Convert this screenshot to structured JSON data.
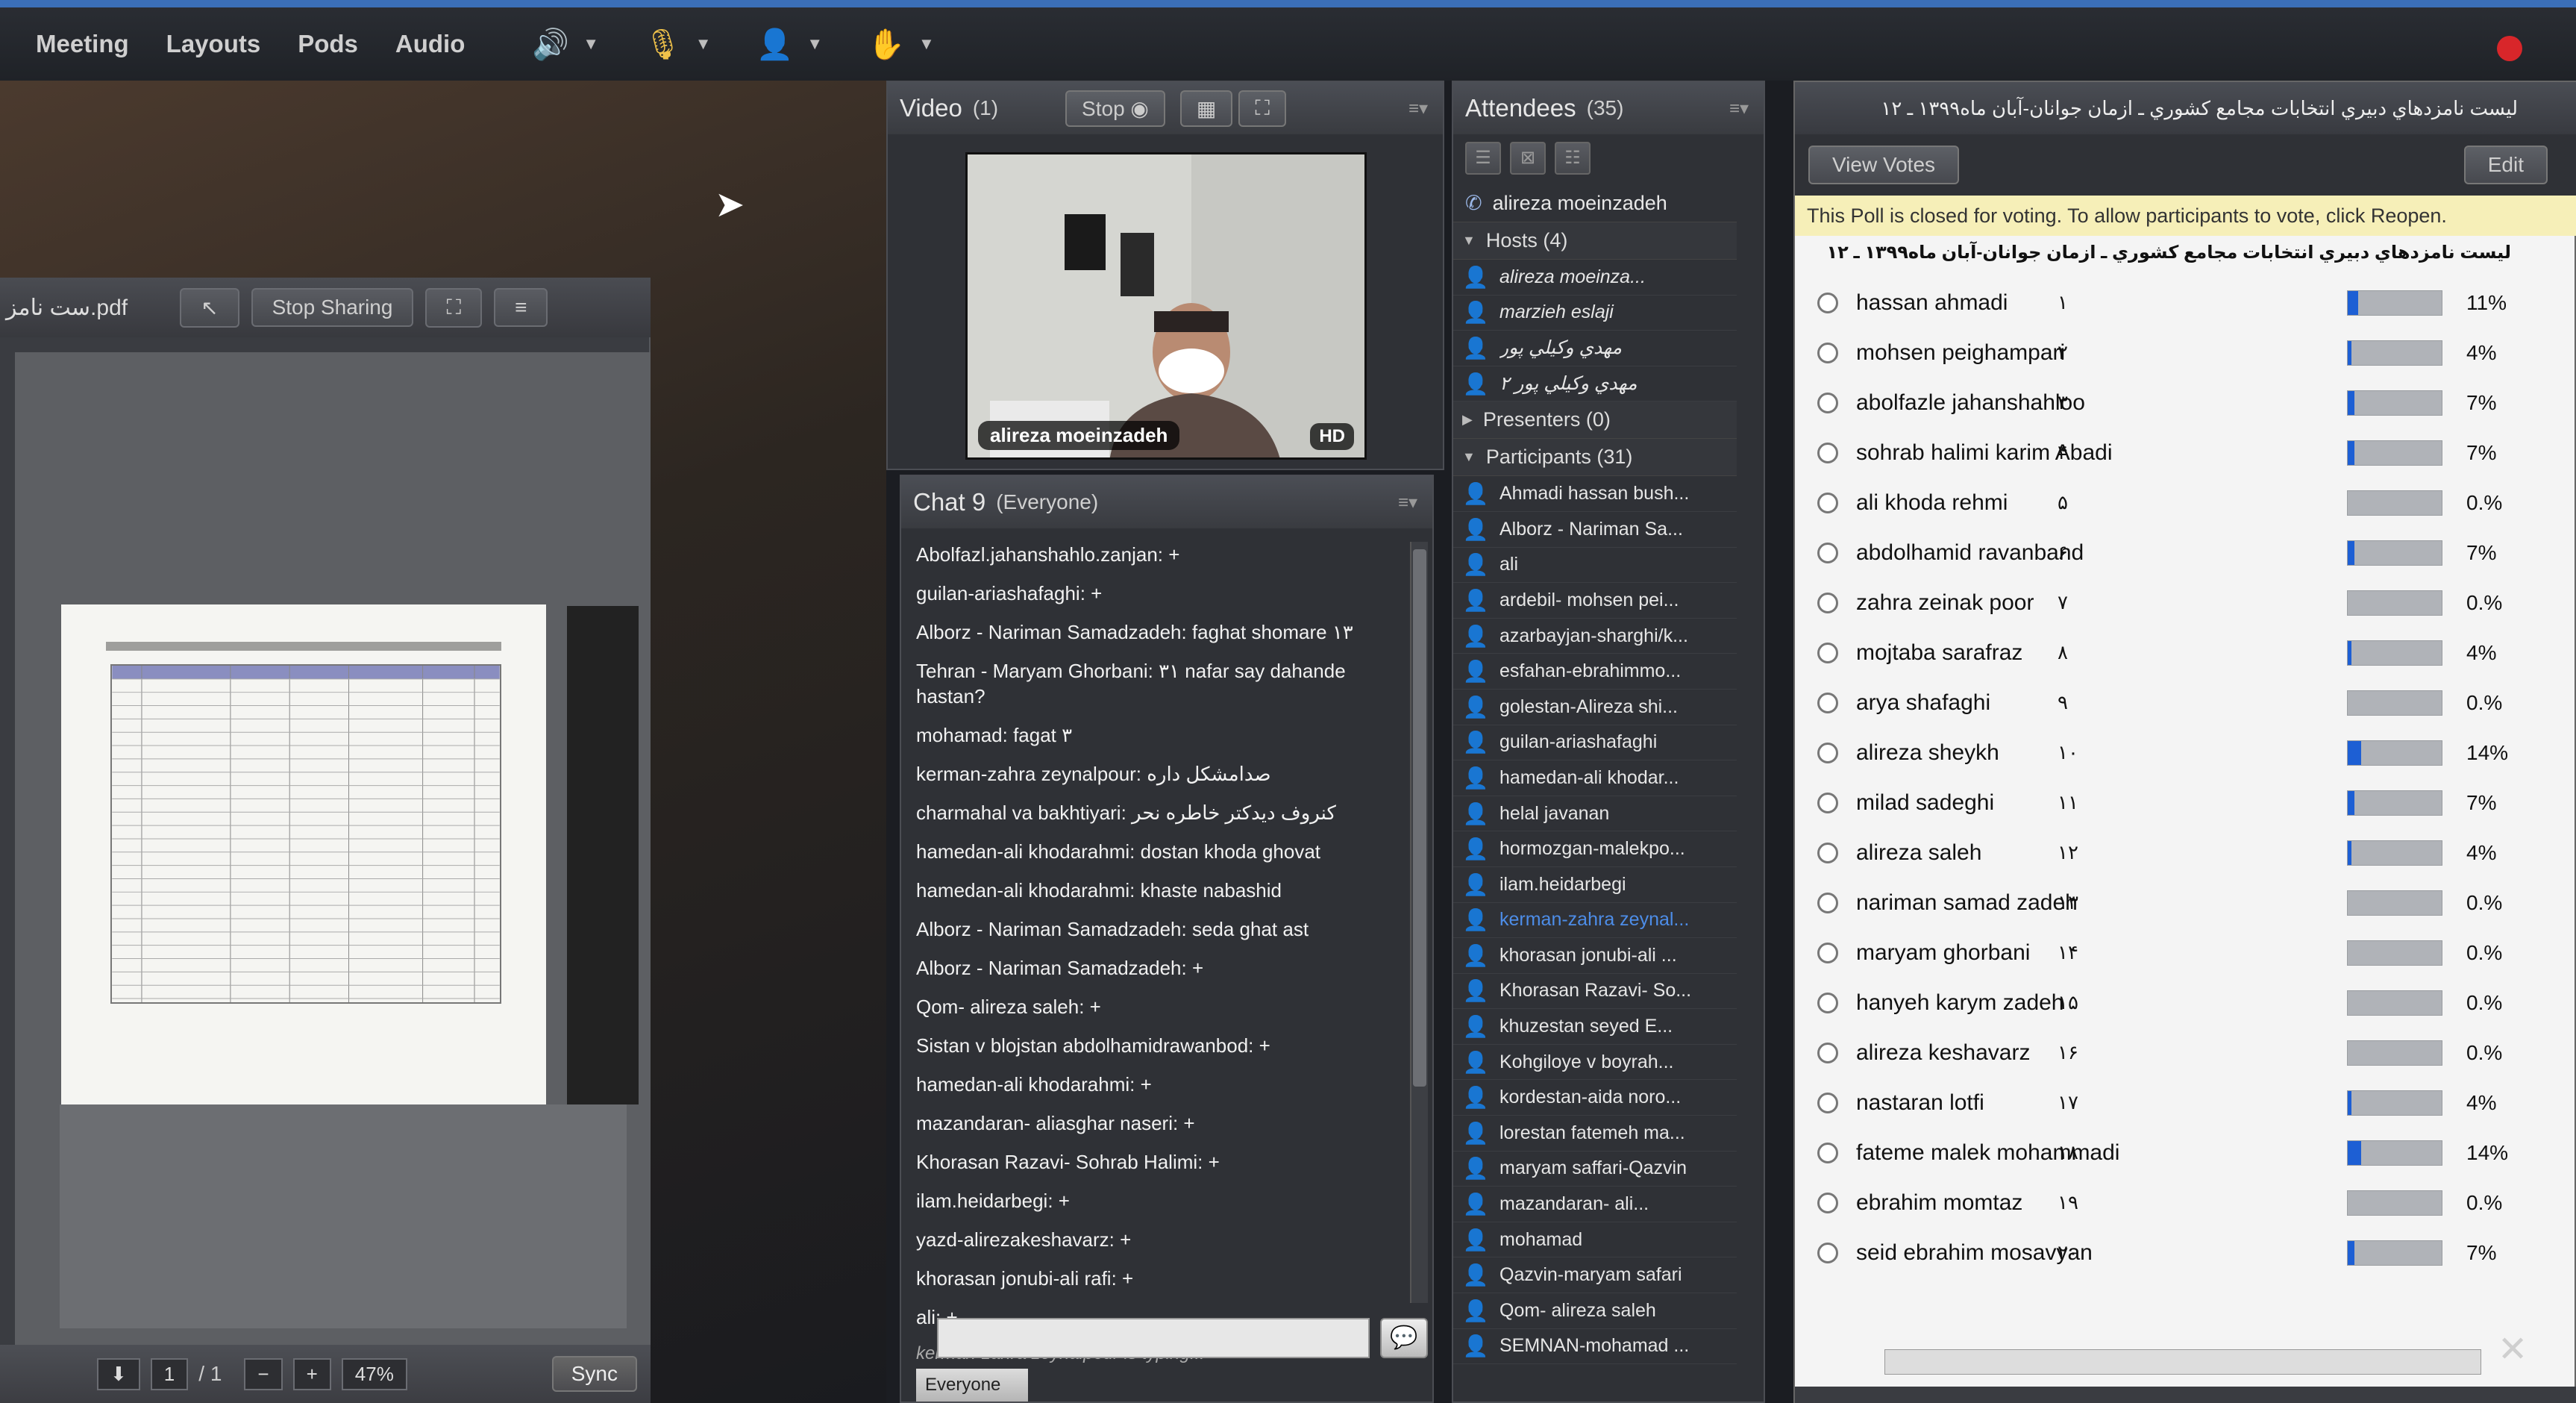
{
  "menubar": {
    "items": [
      "Meeting",
      "Layouts",
      "Pods",
      "Audio"
    ]
  },
  "share": {
    "file_name": "ست نامز.pdf",
    "stop_sharing": "Stop Sharing",
    "page_current": "1",
    "page_total": "/ 1",
    "zoom": "47%",
    "sync": "Sync"
  },
  "video": {
    "title": "Video",
    "count": "(1)",
    "stop": "Stop",
    "participant_name": "alireza moeinzadeh",
    "hd": "HD"
  },
  "chat": {
    "title": "Chat 9",
    "scope_label": "(Everyone)",
    "messages": [
      "Abolfazl.jahanshahlo.zanjan: +",
      "guilan-ariashafaghi: +",
      "Alborz - Nariman Samadzadeh: faghat shomare ۱۳",
      "Tehran - Maryam Ghorbani: ۳۱ nafar say dahande hastan?",
      "mohamad: fagat ۳",
      "kerman-zahra zeynalpour: صدامشکل داره",
      "charmahal va bakhtiyari: کنروف دیدکتر خاطره نحر",
      "hamedan-ali khodarahmi: dostan khoda ghovat",
      "hamedan-ali khodarahmi: khaste nabashid",
      "Alborz - Nariman Samadzadeh: seda ghat ast",
      "Alborz - Nariman Samadzadeh: +",
      "Qom- alireza saleh: +",
      "Sistan v blojstan abdolhamidrawanbod: +",
      "hamedan-ali khodarahmi: +",
      "mazandaran- aliasghar naseri: +",
      "Khorasan Razavi- Sohrab Halimi: +",
      "ilam.heidarbegi: +",
      "yazd-alirezakeshavarz: +",
      "khorasan jonubi-ali rafi: +",
      "ali: +"
    ],
    "typing": "kerman-zahra zeynalpour is typing...",
    "scope_select": "Everyone"
  },
  "attendees": {
    "title": "Attendees",
    "count": "(35)",
    "me": "alireza moeinzadeh",
    "hosts_label": "Hosts (4)",
    "hosts": [
      "alireza moeinza...",
      "marzieh eslaji",
      "مهدي وكيلي پور",
      "مهدي وكيلي پور ۲"
    ],
    "presenters_label": "Presenters (0)",
    "participants_label": "Participants (31)",
    "participants": [
      "Ahmadi hassan bush...",
      "Alborz - Nariman Sa...",
      "ali",
      "ardebil- mohsen pei...",
      "azarbayjan-sharghi/k...",
      "esfahan-ebrahimmo...",
      "golestan-Alireza shi...",
      "guilan-ariashafaghi",
      "hamedan-ali khodar...",
      "helal javanan",
      "hormozgan-malekpo...",
      "ilam.heidarbegi",
      "kerman-zahra zeynal...",
      "khorasan jonubi-ali ...",
      "Khorasan Razavi- So...",
      "khuzestan seyed E...",
      "Kohgiloye v boyrah...",
      "kordestan-aida noro...",
      "lorestan fatemeh ma...",
      "maryam saffari-Qazvin",
      "mazandaran- ali...",
      "mohamad",
      "Qazvin-maryam safari",
      "Qom- alireza saleh",
      "SEMNAN-mohamad ..."
    ],
    "highlighted": "kerman-zahra zeynal..."
  },
  "poll": {
    "title": "ليست نامزدهاي دبيري انتخابات مجامع كشوري ـ ازمان جوانان-آبان ماه۱۳۹۹ ـ ۱۲",
    "view_votes": "View Votes",
    "edit": "Edit",
    "closed_notice": "This Poll is closed for voting. To allow participants to vote, click Reopen.",
    "question": "ليست نامزدهاي دبيري انتخابات مجامع كشوري ـ ازمان جوانان-آبان ماه۱۳۹۹ ـ ۱۲",
    "options": [
      {
        "name": "hassan ahmadi",
        "num": "۱",
        "pct": 11,
        "label": "11%"
      },
      {
        "name": "mohsen peighampari",
        "num": "۲",
        "pct": 4,
        "label": "4%"
      },
      {
        "name": "abolfazle jahanshahloo",
        "num": "۳",
        "pct": 7,
        "label": "7%"
      },
      {
        "name": "sohrab halimi karim Abadi",
        "num": "۴",
        "pct": 7,
        "label": "7%"
      },
      {
        "name": "ali khoda rehmi",
        "num": "۵",
        "pct": 0,
        "label": "0.%"
      },
      {
        "name": "abdolhamid ravanband",
        "num": "۶",
        "pct": 7,
        "label": "7%"
      },
      {
        "name": "zahra zeinak poor",
        "num": "۷",
        "pct": 0,
        "label": "0.%"
      },
      {
        "name": "mojtaba sarafraz",
        "num": "۸",
        "pct": 4,
        "label": "4%"
      },
      {
        "name": "arya shafaghi",
        "num": "۹",
        "pct": 0,
        "label": "0.%"
      },
      {
        "name": "alireza sheykh",
        "num": "۱۰",
        "pct": 14,
        "label": "14%"
      },
      {
        "name": "milad sadeghi",
        "num": "۱۱",
        "pct": 7,
        "label": "7%"
      },
      {
        "name": "alireza saleh",
        "num": "۱۲",
        "pct": 4,
        "label": "4%"
      },
      {
        "name": "nariman samad zadeh",
        "num": "۱۳",
        "pct": 0,
        "label": "0.%"
      },
      {
        "name": "maryam ghorbani",
        "num": "۱۴",
        "pct": 0,
        "label": "0.%"
      },
      {
        "name": "hanyeh karym zadeh",
        "num": "۱۵",
        "pct": 0,
        "label": "0.%"
      },
      {
        "name": "alireza keshavarz",
        "num": "۱۶",
        "pct": 0,
        "label": "0.%"
      },
      {
        "name": "nastaran lotfi",
        "num": "۱۷",
        "pct": 4,
        "label": "4%"
      },
      {
        "name": "fateme malek mohammadi",
        "num": "۱۸",
        "pct": 14,
        "label": "14%"
      },
      {
        "name": "ebrahim momtaz",
        "num": "۱۹",
        "pct": 0,
        "label": "0.%"
      },
      {
        "name": "seid ebrahim mosavyan",
        "num": "۲۰",
        "pct": 7,
        "label": "7%"
      }
    ]
  },
  "colors": {
    "accent": "#1d5fd4",
    "record": "#d8262a",
    "notice": "#f6efb8"
  }
}
